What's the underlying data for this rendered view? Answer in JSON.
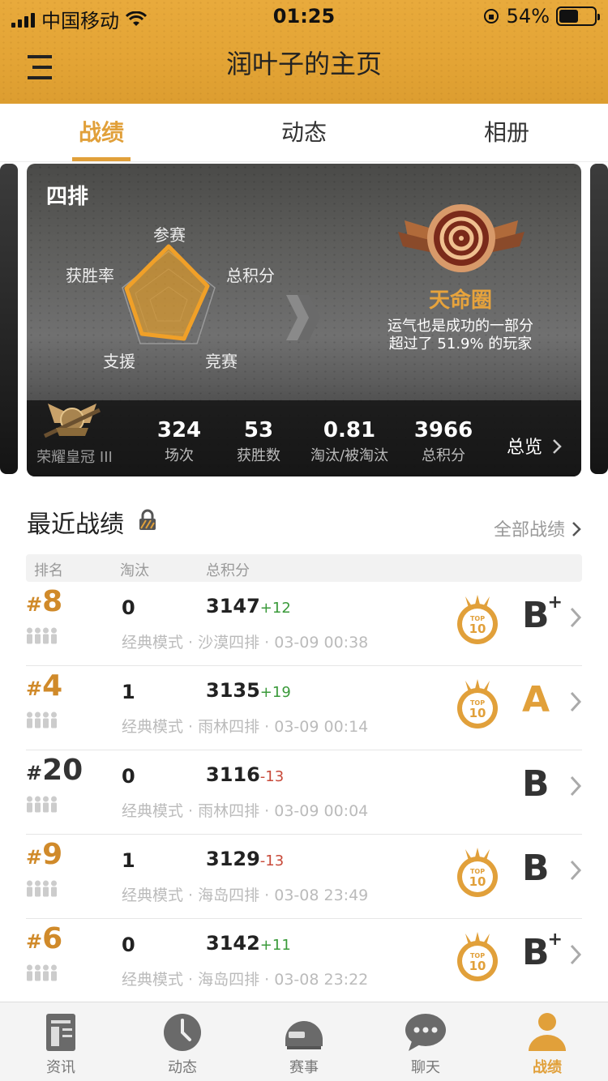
{
  "status": {
    "carrier": "中国移动",
    "time": "01:25",
    "battery": "54%",
    "battery_level": 0.54
  },
  "header": {
    "title": "润叶子的主页"
  },
  "tabs": [
    {
      "label": "战绩"
    },
    {
      "label": "动态"
    },
    {
      "label": "相册"
    }
  ],
  "card": {
    "mode": "四排",
    "radar": {
      "labels": {
        "participation": "参赛",
        "score": "总积分",
        "competition": "竞赛",
        "support": "支援",
        "win_rate": "获胜率"
      }
    },
    "rank_name": "天命圈",
    "rank_desc_1": "运气也是成功的一部分",
    "rank_desc_2": "超过了 51.9% 的玩家",
    "tier": "荣耀皇冠 III",
    "stats": [
      {
        "value": "324",
        "label": "场次"
      },
      {
        "value": "53",
        "label": "获胜数"
      },
      {
        "value": "0.81",
        "label": "淘汰/被淘汰"
      },
      {
        "value": "3966",
        "label": "总积分"
      }
    ],
    "overview": "总览"
  },
  "recent": {
    "title": "最近战绩",
    "all_link": "全部战绩",
    "headers": {
      "rank": "排名",
      "kills": "淘汰",
      "score": "总积分"
    },
    "rows": [
      {
        "rank": "8",
        "kills": "0",
        "score": "3147",
        "delta": "+12",
        "meta": "经典模式 · 沙漠四排 · 03-09 00:38",
        "top10": true,
        "grade": "B",
        "plus": "+"
      },
      {
        "rank": "4",
        "kills": "1",
        "score": "3135",
        "delta": "+19",
        "meta": "经典模式 · 雨林四排 · 03-09 00:14",
        "top10": true,
        "grade": "A",
        "plus": ""
      },
      {
        "rank": "20",
        "kills": "0",
        "score": "3116",
        "delta": "-13",
        "meta": "经典模式 · 雨林四排 · 03-09 00:04",
        "top10": false,
        "grade": "B",
        "plus": ""
      },
      {
        "rank": "9",
        "kills": "1",
        "score": "3129",
        "delta": "-13",
        "meta": "经典模式 · 海岛四排 · 03-08 23:49",
        "top10": true,
        "grade": "B",
        "plus": ""
      },
      {
        "rank": "6",
        "kills": "0",
        "score": "3142",
        "delta": "+11",
        "meta": "经典模式 · 海岛四排 · 03-08 23:22",
        "top10": true,
        "grade": "B",
        "plus": "+"
      }
    ]
  },
  "nav": [
    {
      "label": "资讯",
      "icon": "news-icon"
    },
    {
      "label": "动态",
      "icon": "moments-icon"
    },
    {
      "label": "赛事",
      "icon": "helmet-icon"
    },
    {
      "label": "聊天",
      "icon": "chat-icon"
    },
    {
      "label": "战绩",
      "icon": "profile-icon"
    }
  ],
  "colors": {
    "accent": "#e1a03a",
    "positive": "#3a9a3a",
    "negative": "#c84a3a",
    "top_rank": "#d08a2a",
    "other_rank": "#333333"
  }
}
